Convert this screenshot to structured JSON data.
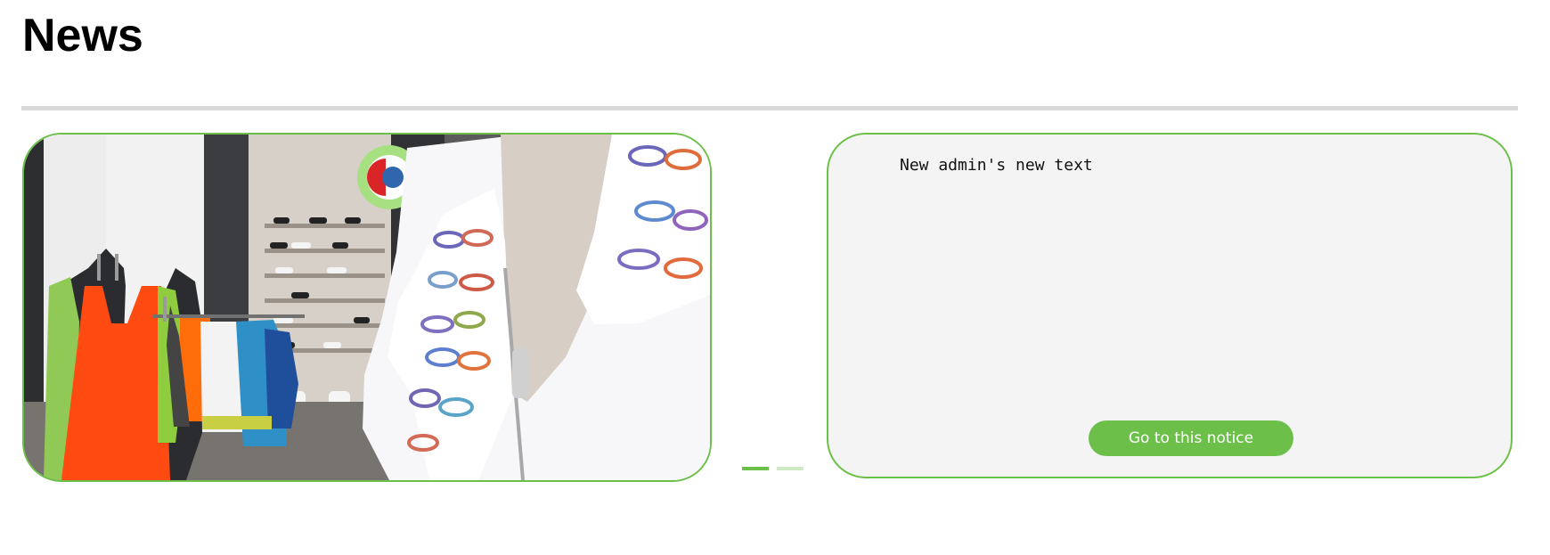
{
  "page": {
    "title": "News"
  },
  "carousel": {
    "slide_count": 2,
    "active_slide": 1
  },
  "notice": {
    "text": "New admin's new text",
    "button_label": "Go to this notice"
  },
  "colors": {
    "accent": "#6cc04a",
    "accent_light": "#cfe9c2",
    "divider": "#d9d9d9",
    "card_background": "#f4f4f4"
  },
  "icons": {
    "news_image": "store-clothing-photo"
  }
}
